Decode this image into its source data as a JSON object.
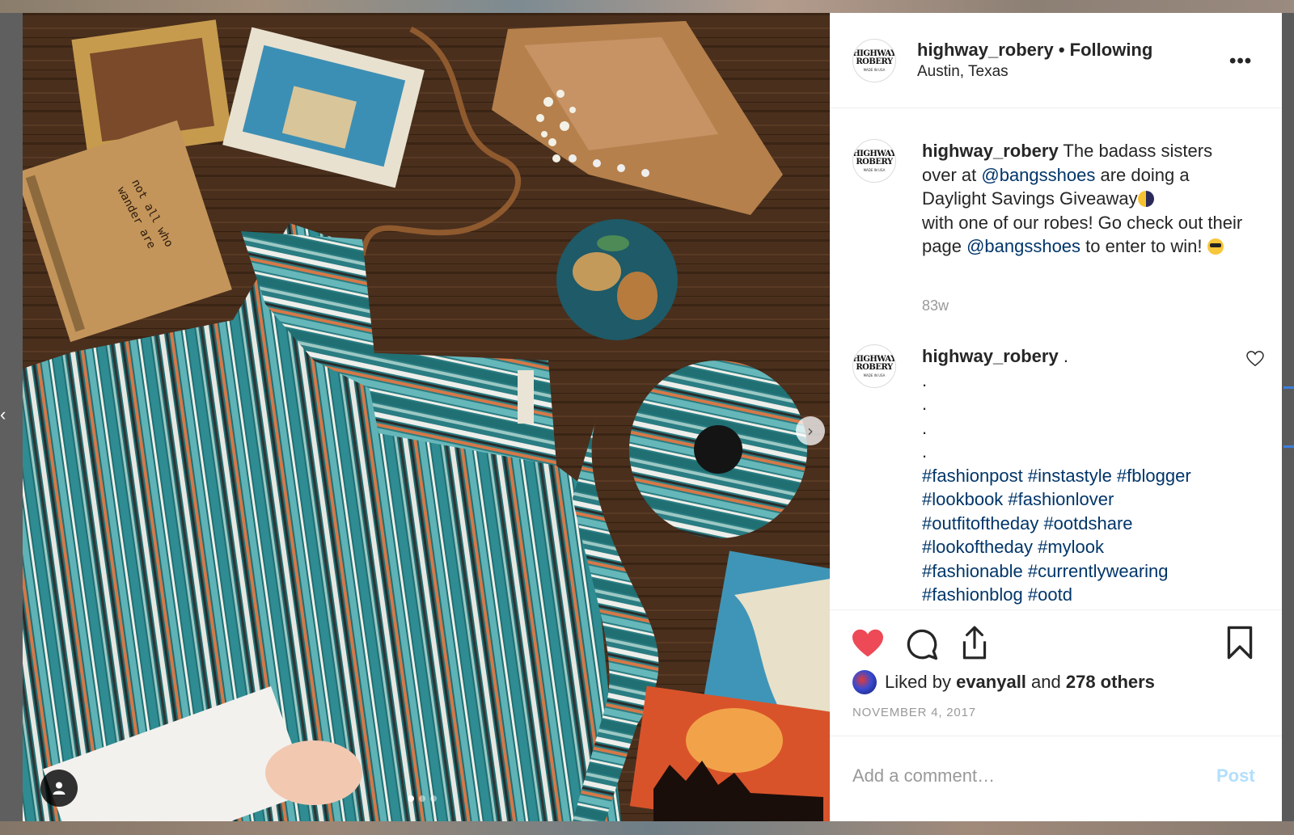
{
  "post": {
    "username": "highway_robery",
    "separator": "•",
    "follow_status": "Following",
    "location": "Austin, Texas",
    "more_icon": "ellipsis-icon",
    "avatar_text_line1": "HIGHWAY",
    "avatar_text_line2": "ROBERY",
    "avatar_text_line3": "MADE IN USA"
  },
  "caption": {
    "username": "highway_robery",
    "text_1": " The badass sisters over at ",
    "mention_1": "@bangsshoes",
    "text_2": " are doing a Daylight Savings Giveaway",
    "text_3": " with one of our robes! Go check out their page ",
    "mention_2": "@bangsshoes",
    "text_4": " to enter to win! ",
    "time": "83w"
  },
  "comment": {
    "username": "highway_robery",
    "text": " .",
    "dots": [
      ".",
      ".",
      ".",
      "."
    ],
    "hashtags_line1": "#fashionpost #instastyle #fblogger",
    "hashtags_line2": "#lookbook #fashionlover",
    "hashtags_line3": "#outfitoftheday #ootdshare",
    "hashtags_line4": "#lookoftheday #mylook",
    "hashtags_line5": "#fashionable #currentlywearing",
    "hashtags_line6": "#fashionblog #ootd"
  },
  "actions": {
    "like_icon": "heart-filled-icon",
    "comment_icon": "comment-bubble-icon",
    "share_icon": "share-upload-icon",
    "save_icon": "bookmark-icon",
    "like_color": "#ed4956",
    "liked_by_prefix": "Liked by ",
    "liked_by_user": "evanyall",
    "liked_by_mid": " and ",
    "liked_by_others": "278 others",
    "date": "NOVEMBER 4, 2017"
  },
  "add_comment": {
    "placeholder": "Add a comment…",
    "post_label": "Post",
    "post_color": "#b2dffc"
  },
  "carousel": {
    "current": 1,
    "total": 3,
    "next_icon": "chevron-right-icon",
    "user_tag_icon": "user-tag-icon"
  }
}
